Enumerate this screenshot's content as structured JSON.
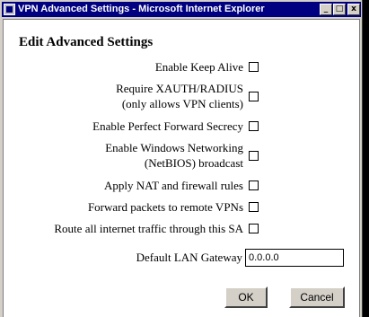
{
  "window": {
    "title": "VPN Advanced Settings - Microsoft Internet Explorer",
    "minimize_glyph": "_",
    "maximize_glyph": "□",
    "close_glyph": "x"
  },
  "form": {
    "heading": "Edit Advanced Settings",
    "options": [
      {
        "label_lines": [
          "Enable Keep Alive"
        ],
        "checked": false
      },
      {
        "label_lines": [
          "Require XAUTH/RADIUS",
          "(only allows VPN clients)"
        ],
        "checked": false
      },
      {
        "label_lines": [
          "Enable Perfect Forward Secrecy"
        ],
        "checked": false
      },
      {
        "label_lines": [
          "Enable Windows Networking",
          "(NetBIOS) broadcast"
        ],
        "checked": false
      },
      {
        "label_lines": [
          "Apply NAT and firewall rules"
        ],
        "checked": false
      },
      {
        "label_lines": [
          "Forward packets to remote VPNs"
        ],
        "checked": false
      },
      {
        "label_lines": [
          "Route all internet traffic through this SA"
        ],
        "checked": false
      }
    ],
    "gateway_label": "Default LAN Gateway",
    "gateway_value": "0.0.0.0",
    "ok_label": "OK",
    "cancel_label": "Cancel"
  }
}
